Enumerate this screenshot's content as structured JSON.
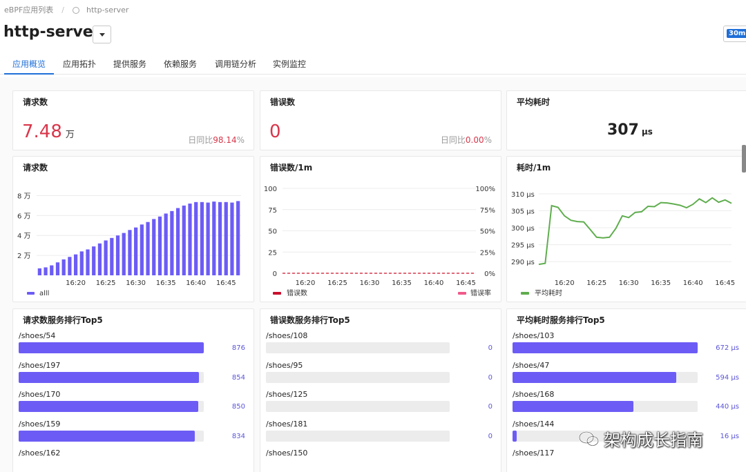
{
  "breadcrumb": {
    "root": "eBPF应用列表",
    "separator": "/",
    "current": "http-server"
  },
  "header": {
    "title": "http-server",
    "time_range": "30m"
  },
  "tabs": [
    {
      "label": "应用概览",
      "active": true
    },
    {
      "label": "应用拓扑",
      "active": false
    },
    {
      "label": "提供服务",
      "active": false
    },
    {
      "label": "依赖服务",
      "active": false
    },
    {
      "label": "调用链分析",
      "active": false
    },
    {
      "label": "实例监控",
      "active": false
    }
  ],
  "stats": {
    "requests": {
      "title": "请求数",
      "value": "7.48",
      "unit": "万",
      "ratio_label": "日同比",
      "ratio_value": "98.14",
      "ratio_unit": "%"
    },
    "errors": {
      "title": "错误数",
      "value": "0",
      "ratio_label": "日同比",
      "ratio_value": "0.00",
      "ratio_unit": "%"
    },
    "latency": {
      "title": "平均耗时",
      "value": "307",
      "unit": "μs"
    }
  },
  "colors": {
    "accent": "#1f6fd8",
    "bar": "#6c5cf5",
    "error_line": "#d9364a",
    "latency_line": "#5fad4e",
    "red_text": "#d9364a"
  },
  "chart_data": [
    {
      "type": "bar",
      "title": "请求数",
      "y_ticks": [
        "2 万",
        "4 万",
        "6 万",
        "8 万"
      ],
      "x_ticks": [
        "16:20",
        "16:25",
        "16:30",
        "16:35",
        "16:40",
        "16:45"
      ],
      "ylim": [
        0,
        90000
      ],
      "series": [
        {
          "name": "alll",
          "values": [
            7000,
            8000,
            10000,
            13000,
            16000,
            18500,
            21000,
            24000,
            26000,
            29000,
            32000,
            35000,
            37500,
            40000,
            42500,
            45500,
            48000,
            51000,
            53500,
            56500,
            59000,
            62000,
            64500,
            67500,
            70000,
            72000,
            73500,
            73500,
            73000,
            74000,
            73500,
            73500,
            73000,
            74500
          ]
        }
      ],
      "legend": "bottom-left"
    },
    {
      "type": "line",
      "title": "错误数/1m",
      "y_ticks_left": [
        "0",
        "25",
        "50",
        "75",
        "100"
      ],
      "y_ticks_right": [
        "0%",
        "25%",
        "50%",
        "75%",
        "100%"
      ],
      "x_ticks": [
        "16:20",
        "16:25",
        "16:30",
        "16:35",
        "16:40",
        "16:45"
      ],
      "ylim": [
        0,
        100
      ],
      "series": [
        {
          "name": "错误数",
          "values": [
            0,
            0,
            0,
            0,
            0,
            0
          ]
        },
        {
          "name": "错误率",
          "values": [
            0,
            0,
            0,
            0,
            0,
            0
          ]
        }
      ],
      "legend": "bottom"
    },
    {
      "type": "line",
      "title": "耗时/1m",
      "y_ticks": [
        "290 μs",
        "295 μs",
        "300 μs",
        "305 μs",
        "310 μs"
      ],
      "x_ticks": [
        "16:20",
        "16:25",
        "16:30",
        "16:35",
        "16:40",
        "16:45"
      ],
      "ylim": [
        288,
        312
      ],
      "series": [
        {
          "name": "平均耗时",
          "values": [
            289.2,
            289.5,
            306.5,
            306,
            303.5,
            302.2,
            301.8,
            301.7,
            299.5,
            297.2,
            297,
            297.2,
            299.8,
            303.5,
            303,
            304.5,
            304.7,
            306.3,
            306.2,
            307.4,
            307.3,
            307,
            306.6,
            305.9,
            306.9,
            308.5,
            307.4,
            308.8,
            307.5,
            308.2,
            307.2
          ]
        }
      ],
      "legend": "bottom-left"
    }
  ],
  "rankings": {
    "requests": {
      "title": "请求数服务排行Top5",
      "max": 876,
      "items": [
        {
          "label": "/shoes/54",
          "value": 876,
          "display": "876"
        },
        {
          "label": "/shoes/197",
          "value": 854,
          "display": "854"
        },
        {
          "label": "/shoes/170",
          "value": 850,
          "display": "850"
        },
        {
          "label": "/shoes/159",
          "value": 834,
          "display": "834"
        },
        {
          "label": "/shoes/162",
          "value": 0,
          "display": ""
        }
      ]
    },
    "errors": {
      "title": "错误数服务排行Top5",
      "max": 1,
      "items": [
        {
          "label": "/shoes/108",
          "value": 0,
          "display": "0"
        },
        {
          "label": "/shoes/95",
          "value": 0,
          "display": "0"
        },
        {
          "label": "/shoes/125",
          "value": 0,
          "display": "0"
        },
        {
          "label": "/shoes/181",
          "value": 0,
          "display": "0"
        },
        {
          "label": "/shoes/150",
          "value": 0,
          "display": ""
        }
      ]
    },
    "latency": {
      "title": "平均耗时服务排行Top5",
      "max": 672,
      "items": [
        {
          "label": "/shoes/103",
          "value": 672,
          "display": "672 μs"
        },
        {
          "label": "/shoes/47",
          "value": 594,
          "display": "594 μs"
        },
        {
          "label": "/shoes/168",
          "value": 440,
          "display": "440 μs"
        },
        {
          "label": "/shoes/144",
          "value": 16,
          "display": "16 μs"
        },
        {
          "label": "/shoes/117",
          "value": 0,
          "display": ""
        }
      ]
    }
  },
  "watermark": {
    "text": "架构成长指南"
  }
}
